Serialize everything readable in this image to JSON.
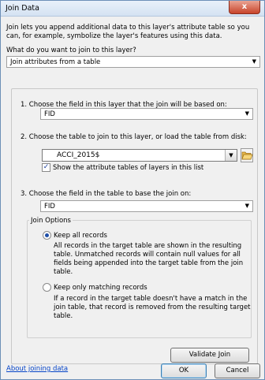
{
  "window": {
    "title": "Join Data",
    "close_symbol": "x"
  },
  "intro": "Join lets you append additional data to this layer's attribute table so you can, for example, symbolize the layer's features using this data.",
  "question": "What do you want to join to this layer?",
  "join_type": {
    "value": "Join attributes from a table"
  },
  "step1": {
    "label": "1.  Choose the field in this layer that the join will be based on:",
    "value": "FID"
  },
  "step2": {
    "label": "2.  Choose the table to join to this layer, or load the table from disk:",
    "table_value": "ACCI_2015$",
    "show_layers_label": "Show the attribute tables of layers in this list",
    "show_layers_checked": true
  },
  "step3": {
    "label": "3.  Choose the field in the table to base the join on:",
    "value": "FID"
  },
  "join_options": {
    "legend": "Join Options",
    "keep_all": {
      "label": "Keep all records",
      "description": "All records in the target table are shown in the resulting table. Unmatched records will contain null values for all fields being appended into the target table from the join table.",
      "selected": true
    },
    "keep_matching": {
      "label": "Keep only matching records",
      "description": "If a record in the target table doesn't have a match in the join table, that record is removed from the resulting target table.",
      "selected": false
    }
  },
  "buttons": {
    "validate": "Validate Join",
    "ok": "OK",
    "cancel": "Cancel"
  },
  "footer_link": "About joining data",
  "icons": {
    "dropdown": "chevron-down-icon",
    "folder": "open-folder-icon",
    "check": "checkmark-icon"
  }
}
